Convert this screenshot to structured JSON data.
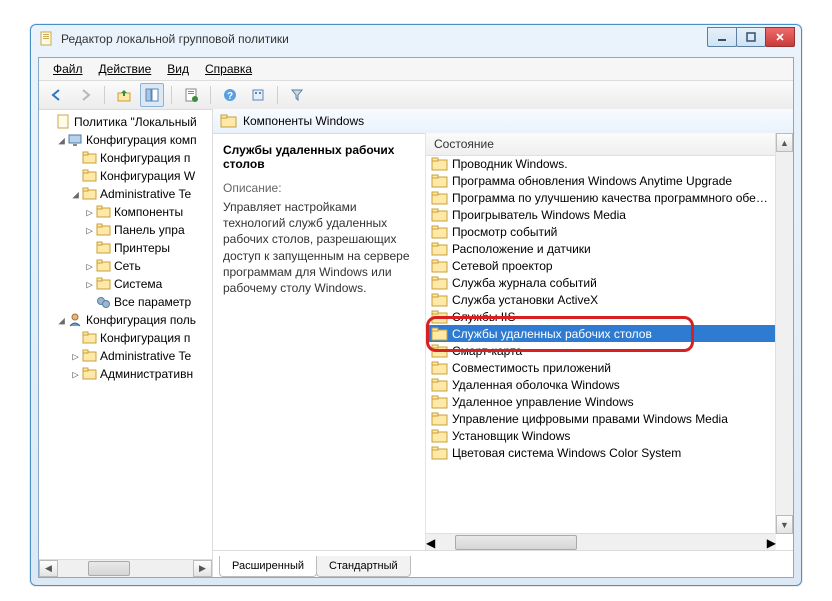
{
  "window": {
    "title": "Редактор локальной групповой политики"
  },
  "menu": {
    "file": "Файл",
    "action": "Действие",
    "view": "Вид",
    "help": "Справка"
  },
  "tree": {
    "root": "Политика \"Локальный",
    "n1": "Конфигурация комп",
    "n1a": "Конфигурация п",
    "n1b": "Конфигурация W",
    "n1c": "Administrative Te",
    "n1c1": "Компоненты",
    "n1c2": "Панель упра",
    "n1c3": "Принтеры",
    "n1c4": "Сеть",
    "n1c5": "Система",
    "n1c6": "Все параметр",
    "n2": "Конфигурация поль",
    "n2a": "Конфигурация п",
    "n2b": "Administrative Te",
    "n2c": "Административн"
  },
  "crumb": {
    "label": "Компоненты Windows"
  },
  "desc": {
    "title": "Службы удаленных рабочих столов",
    "label": "Описание:",
    "text": "Управляет настройками технологий служб удаленных рабочих столов, разрешающих доступ к запущенным на сервере программам для Windows или рабочему столу Windows."
  },
  "listheader": "Состояние",
  "items": [
    "Проводник Windows.",
    "Программа обновления Windows Anytime Upgrade",
    "Программа по улучшению качества программного обе…",
    "Проигрыватель Windows Media",
    "Просмотр событий",
    "Расположение и датчики",
    "Сетевой проектор",
    "Служба журнала событий",
    "Служба установки ActiveX",
    "Службы IIS",
    "Службы удаленных рабочих столов",
    "Смарт-карта",
    "Совместимость приложений",
    "Удаленная оболочка Windows",
    "Удаленное управление Windows",
    "Управление цифровыми правами Windows Media",
    "Установщик Windows",
    "Цветовая система Windows Color System"
  ],
  "selectedIndex": 10,
  "tabs": {
    "ext": "Расширенный",
    "std": "Стандартный"
  }
}
